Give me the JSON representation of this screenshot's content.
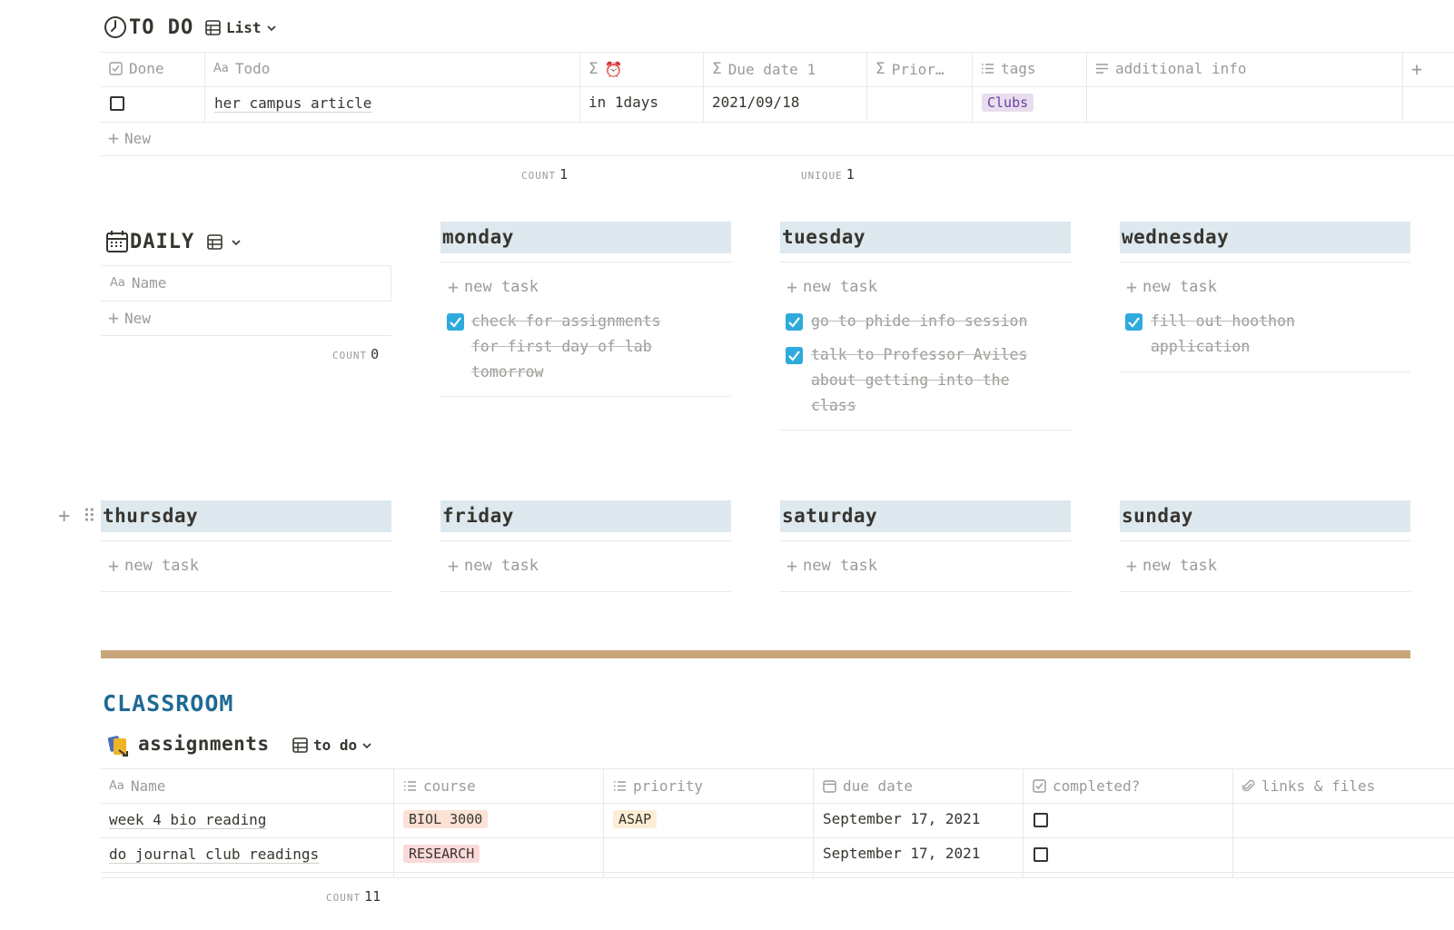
{
  "todo": {
    "title": "TO DO",
    "view_label": "List",
    "columns": [
      "Done",
      "Todo",
      "⏰",
      "Due date 1",
      "Prior…",
      "tags",
      "additional info"
    ],
    "rows": [
      {
        "todo": "her campus article",
        "countdown": "in 1days",
        "due": "2021/09/18",
        "tag": "Clubs"
      }
    ],
    "new_label": "New",
    "count_label": "COUNT",
    "count_value": "1",
    "unique_label": "UNIQUE",
    "unique_value": "1",
    "colors": {
      "tag_clubs_bg": "#e8deee",
      "tag_clubs_fg": "#6940a5"
    }
  },
  "daily": {
    "title": "DAILY",
    "name_col": "Name",
    "new_label": "New",
    "count_label": "COUNT",
    "count_value": "0"
  },
  "days": {
    "new_task_label": "new task",
    "monday": {
      "label": "monday",
      "tasks": [
        "check for assignments",
        "for first day of lab",
        "tomorrow"
      ]
    },
    "tuesday": {
      "label": "tuesday",
      "tasks": [
        "go to phide info session",
        "talk to Professor Aviles",
        "about getting into the",
        "class"
      ]
    },
    "wednesday": {
      "label": "wednesday",
      "tasks": [
        "fill out hoothon",
        "application"
      ]
    },
    "thursday": {
      "label": "thursday"
    },
    "friday": {
      "label": "friday"
    },
    "saturday": {
      "label": "saturday"
    },
    "sunday": {
      "label": "sunday"
    },
    "colors": {
      "header_bg": "#dde8ef",
      "check": "#2eaadc"
    }
  },
  "divider_color": "#c9a67a",
  "classroom": {
    "title": "CLASSROOM",
    "title_color": "#1f6a94",
    "assignments_title": "assignments",
    "view_label": "to do",
    "columns": [
      "Name",
      "course",
      "priority",
      "due date",
      "completed?",
      "links & files"
    ],
    "rows": [
      {
        "name": "week 4 bio reading",
        "course": "BIOL 3000",
        "priority": "ASAP",
        "due": "September 17, 2021"
      },
      {
        "name": "do journal club readings",
        "course": "RESEARCH",
        "priority": "",
        "due": "September 17, 2021"
      }
    ],
    "count_label": "COUNT",
    "count_value": "11",
    "colors": {
      "biol_bg": "#fbe2d5",
      "research_bg": "#fbd9d9",
      "asap_bg": "#fbeed4"
    }
  }
}
